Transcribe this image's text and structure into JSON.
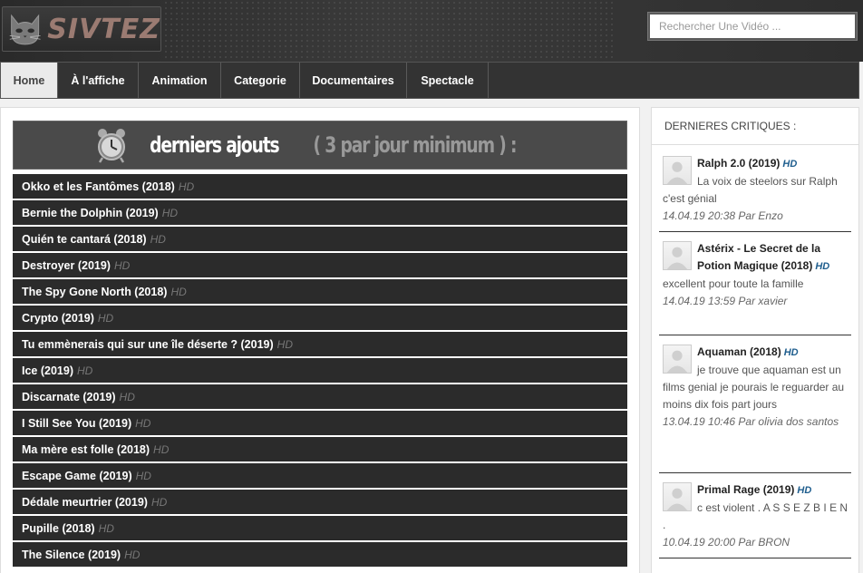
{
  "header": {
    "logo_text": "SIVTEZ",
    "search_placeholder": "Rechercher Une Vidéo ..."
  },
  "nav": {
    "tabs": [
      "Home",
      "À l'affiche",
      "Animation",
      "Categorie",
      "Documentaires",
      "Spectacle"
    ]
  },
  "main": {
    "banner_main": "derniers ajouts",
    "banner_sub": "( 3 par jour minimum ) :",
    "hd_label": "HD",
    "items": [
      "Okko et les Fantômes (2018)",
      "Bernie the Dolphin (2019)",
      "Quién te cantará (2018)",
      "Destroyer (2019)",
      "The Spy Gone North (2018)",
      "Crypto (2019)",
      "Tu emmènerais qui sur une île déserte ? (2019)",
      "Ice (2019)",
      "Discarnate (2019)",
      "I Still See You (2019)",
      "Ma mère est folle (2018)",
      "Escape Game (2019)",
      "Dédale meurtrier (2019)",
      "Pupille (2018)",
      "The Silence (2019)"
    ]
  },
  "sidebar": {
    "title": "DERNIERES CRITIQUES :",
    "hd_label": "HD",
    "critiques": [
      {
        "title": "Ralph 2.0 (2019)",
        "text": "La voix de steelors sur Ralph c'est génial",
        "meta": "14.04.19 20:38 Par Enzo"
      },
      {
        "title": "Astérix - Le Secret de la Potion Magique (2018)",
        "text": "excellent pour toute la famille",
        "meta": "14.04.19 13:59 Par xavier"
      },
      {
        "title": "Aquaman (2018)",
        "text": "je trouve que aquaman est un films genial je pourais le reguarder au moins dix fois part jours",
        "meta": "13.04.19 10:46 Par olivia dos santos"
      },
      {
        "title": "Primal Rage (2019)",
        "text": "c est violent . A S S E Z B I E N .",
        "meta": "10.04.19 20:00 Par BRON"
      }
    ]
  }
}
